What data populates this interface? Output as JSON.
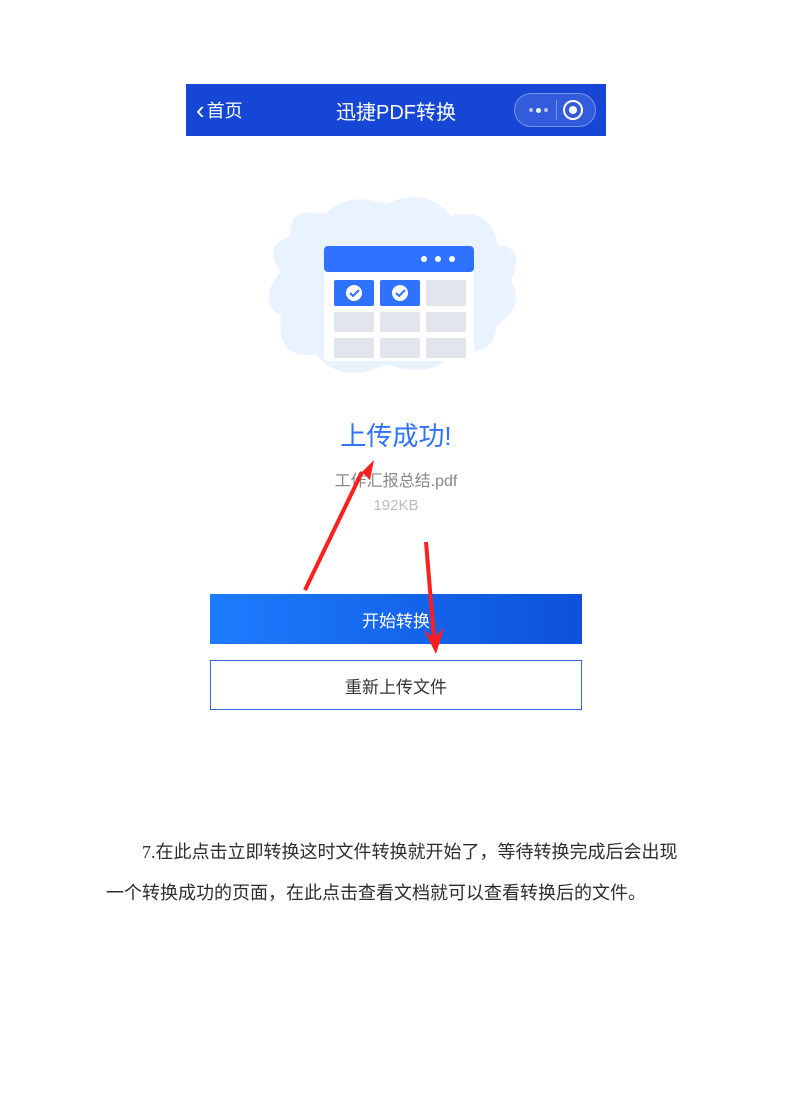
{
  "nav": {
    "back_label": "首页",
    "title": "迅捷PDF转换"
  },
  "status": {
    "title": "上传成功!",
    "file_name": "工作汇报总结.pdf",
    "file_size": "192KB"
  },
  "buttons": {
    "primary": "开始转换",
    "secondary": "重新上传文件"
  },
  "step_text": "7.在此点击立即转换这时文件转换就开始了，等待转换完成后会出现一个转换成功的页面，在此点击查看文档就可以查看转换后的文件。"
}
